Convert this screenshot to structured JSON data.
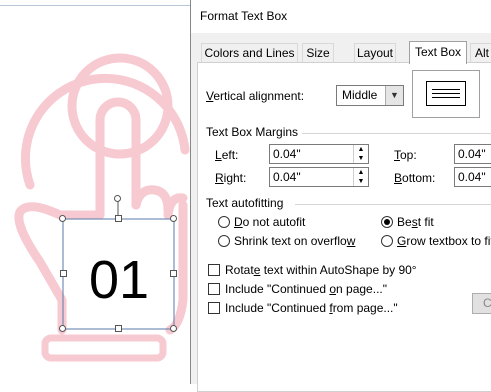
{
  "canvas": {
    "textbox_value": "01",
    "art_color": "#f7c9d1"
  },
  "dialog": {
    "title": "Format Text Box",
    "tabs": [
      {
        "label": "Colors and Lines",
        "active": false
      },
      {
        "label": "Size",
        "active": false
      },
      {
        "label": "Layout",
        "active": false
      },
      {
        "label": "Text Box",
        "active": true
      },
      {
        "label": "Alt",
        "active": false
      }
    ],
    "vertical_alignment": {
      "label_pre": "",
      "label_key": "V",
      "label_post": "ertical alignment:",
      "value": "Middle"
    },
    "margins": {
      "heading": "Text Box Margins",
      "left": {
        "key": "L",
        "rest": "eft:",
        "value": "0.04\""
      },
      "right": {
        "key": "R",
        "rest": "ight:",
        "value": "0.04\""
      },
      "top": {
        "key": "T",
        "rest": "op:",
        "value": "0.04\""
      },
      "bottom": {
        "key": "B",
        "rest": "ottom:",
        "value": "0.04\""
      }
    },
    "autofit": {
      "heading": "Text autofitting",
      "options": [
        {
          "pre": "",
          "key": "D",
          "post": "o not autofit",
          "selected": false
        },
        {
          "pre": "Be",
          "key": "s",
          "post": "t fit",
          "selected": true
        },
        {
          "pre": "Shrink text on overflo",
          "key": "w",
          "post": "",
          "selected": false
        },
        {
          "pre": "",
          "key": "G",
          "post": "row textbox to fit",
          "selected": false
        }
      ]
    },
    "checkboxes": [
      {
        "pre": "Rotat",
        "key": "e",
        "post": " text within AutoShape by 90°",
        "checked": false
      },
      {
        "pre": "Include \"Continued ",
        "key": "o",
        "post": "n page...\"",
        "checked": false
      },
      {
        "pre": "Include \"Continued ",
        "key": "f",
        "post": "rom page...\"",
        "checked": false
      }
    ],
    "side_button": "C"
  }
}
